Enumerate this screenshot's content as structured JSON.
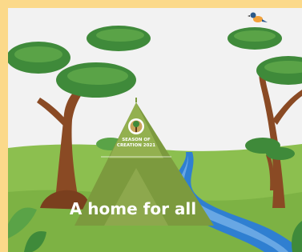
{
  "badge": {
    "line1": "SEASON OF",
    "line2": "CREATION 2021"
  },
  "headline": "A home for all",
  "colors": {
    "frame": "#fbd98a",
    "sky": "#f2f2f2",
    "ground": "#8cbf4f",
    "ground_dark": "#6fa23d",
    "tree_canopy": "#3f8a3a",
    "tree_canopy_light": "#5aa347",
    "trunk": "#8a4a24",
    "tent": "#7c9a3e",
    "tent_light": "#9ab45a",
    "river": "#2f7fd1",
    "river_light": "#8fc2f0",
    "bird_body": "#f2a23a",
    "bird_head": "#2c5a8a"
  },
  "icons": {
    "badge_emblem": "tree-emblem-icon",
    "bird": "bird-icon"
  }
}
